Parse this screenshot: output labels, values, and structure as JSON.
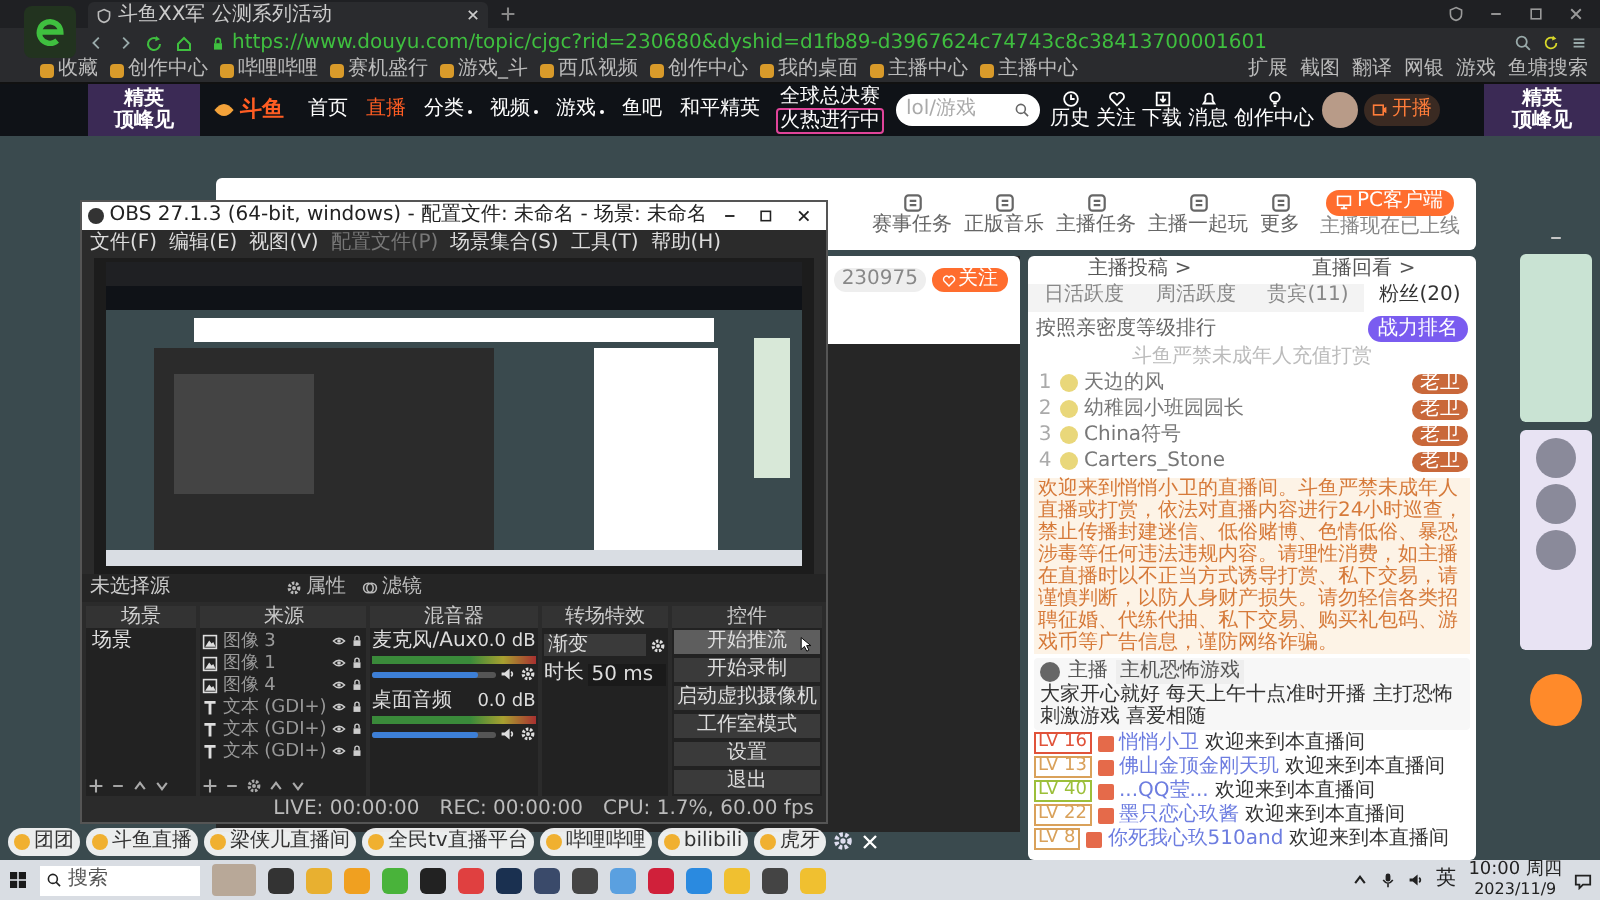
{
  "browser": {
    "tab_title": "斗鱼XX军 公测系列活动",
    "url": "https://www.douyu.com/topic/cjgc?rid=230680&dyshid=d1fb89-d3967624c74743c8c38413700001601",
    "bookmarks": [
      "收藏",
      "创作中心",
      "哔哩哔哩",
      "赛机盛行",
      "游戏_斗",
      "西瓜视频",
      "创作中心",
      "我的桌面",
      "主播中心",
      "主播中心"
    ],
    "bookmarks_right": [
      "扩展",
      "截图",
      "翻译",
      "网银",
      "游戏",
      "鱼塘搜索"
    ]
  },
  "site_nav": {
    "banner_left": [
      "精英",
      "顶峰见"
    ],
    "logo": "斗鱼",
    "items": [
      {
        "label": "首页",
        "selected": false,
        "dropdown": false
      },
      {
        "label": "直播",
        "selected": true,
        "dropdown": false
      },
      {
        "label": "分类",
        "selected": false,
        "dropdown": true
      },
      {
        "label": "视频",
        "selected": false,
        "dropdown": true
      },
      {
        "label": "游戏",
        "selected": false,
        "dropdown": true
      },
      {
        "label": "鱼吧",
        "selected": false,
        "dropdown": false
      },
      {
        "label": "和平精英",
        "selected": false,
        "dropdown": false
      }
    ],
    "promo": [
      "全球总决赛",
      "火热进行中"
    ],
    "search": {
      "placeholder": "lol/游戏"
    },
    "user_menu": [
      {
        "kind": "clock",
        "label": "历史"
      },
      {
        "kind": "heart",
        "label": "关注"
      },
      {
        "kind": "download",
        "label": "下载"
      },
      {
        "kind": "bell",
        "label": "消息"
      },
      {
        "kind": "bulb",
        "label": "创作中心"
      }
    ],
    "start_button": "开播",
    "banner_right": [
      "精英",
      "顶峰见"
    ]
  },
  "toolbar": {
    "tools": [
      "赛事任务",
      "正版音乐",
      "主播任务",
      "主播一起玩",
      "更多"
    ],
    "pc_button": "PC客户端",
    "pc_note": "主播现在已上线"
  },
  "player": {
    "follower_count": "230975",
    "follow_button": "关注"
  },
  "chat": {
    "links": [
      "主播投稿 >",
      "直播回看 >"
    ],
    "tabs": [
      {
        "label": "日活跃度",
        "selected": false
      },
      {
        "label": "周活跃度",
        "selected": false
      },
      {
        "label": "贵宾(11)",
        "selected": false
      },
      {
        "label": "粉丝(20)",
        "selected": true
      }
    ],
    "rank_note": "按照亲密度等级排行",
    "rank_button": "战力排名",
    "warning": "斗鱼严禁未成年人充值打赏",
    "fans": [
      {
        "rank": "1",
        "name": "天边的风",
        "badge": "老卫"
      },
      {
        "rank": "2",
        "name": "幼稚园小班园园长",
        "badge": "老卫"
      },
      {
        "rank": "3",
        "name": "China符号",
        "badge": "老卫"
      },
      {
        "rank": "4",
        "name": "Carters_Stone",
        "badge": "老卫"
      }
    ],
    "notice": "欢迎来到悄悄小卫的直播间。斗鱼严禁未成年人直播或打赏，依法对直播内容进行24小时巡查，禁止传播封建迷信、低俗赌博、色情低俗、暴恐涉毒等任何违法违规内容。请理性消费，如主播在直播时以不正当方式诱导打赏、私下交易，请谨慎判断，以防人身财产损失。请勿轻信各类招聘征婚、代练代抽、私下交易、购买礼包码、游戏币等广告信息，谨防网络诈骗。",
    "host_card": {
      "role": "主播",
      "tag": "主机恐怖游戏",
      "message": "大家开心就好 每天上午十点准时开播 主打恐怖刺激游戏 喜爱相随"
    },
    "welcome": [
      {
        "level": "LV 16",
        "color": "#e0533a",
        "name": "悄悄小卫",
        "text": "欢迎来到本直播间"
      },
      {
        "level": "LV 13",
        "color": "#d9a15a",
        "name": "佛山金顶金刚天玑",
        "text": "欢迎来到本直播间"
      },
      {
        "level": "LV 40",
        "color": "#9cbf3a",
        "name": "...QQ莹...",
        "text": "欢迎来到本直播间"
      },
      {
        "level": "LV 22",
        "color": "#d9a15a",
        "name": "墨只恋心玖酱",
        "text": "欢迎来到本直播间"
      },
      {
        "level": "LV 8",
        "color": "#d9a15a",
        "name": "你死我心玖510and",
        "text": "欢迎来到本直播间"
      }
    ]
  },
  "bottom_bookmarks": [
    "团团",
    "斗鱼直播",
    "梁侠儿直播间",
    "全民tv直播平台",
    "哔哩哔哩",
    "bilibili",
    "虎牙"
  ],
  "obs": {
    "title": "OBS 27.1.3 (64-bit, windows) - 配置文件: 未命名 - 场景: 未命名",
    "menu": [
      {
        "label": "文件(F)",
        "disabled": false
      },
      {
        "label": "编辑(E)",
        "disabled": false
      },
      {
        "label": "视图(V)",
        "disabled": false
      },
      {
        "label": "配置文件(P)",
        "disabled": true
      },
      {
        "label": "场景集合(S)",
        "disabled": false
      },
      {
        "label": "工具(T)",
        "disabled": false
      },
      {
        "label": "帮助(H)",
        "disabled": false
      }
    ],
    "source_bar": {
      "label": "未选择源",
      "buttons": [
        "属性",
        "滤镜"
      ]
    },
    "docks": [
      "场景",
      "来源",
      "混音器",
      "转场特效",
      "控件"
    ],
    "scenes": [
      {
        "name": "场景",
        "selected": false
      }
    ],
    "sources": [
      {
        "kind": "image",
        "name": "图像 3"
      },
      {
        "kind": "image",
        "name": "图像 1"
      },
      {
        "kind": "image",
        "name": "图像 4"
      },
      {
        "kind": "text",
        "name": "文本 (GDI+)"
      },
      {
        "kind": "text",
        "name": "文本 (GDI+)"
      },
      {
        "kind": "text",
        "name": "文本 (GDI+)"
      }
    ],
    "mixer": [
      {
        "name": "麦克风/Aux",
        "reading": "0.0 dB",
        "level": 0.85
      },
      {
        "name": "桌面音频",
        "reading": "0.0 dB",
        "level": 0.85
      }
    ],
    "transition": {
      "type": "渐变",
      "duration_label": "时长",
      "duration": "50 ms"
    },
    "controls": [
      {
        "label": "开始推流",
        "hovered": true
      },
      {
        "label": "开始录制",
        "hovered": false
      },
      {
        "label": "启动虚拟摄像机",
        "hovered": false
      },
      {
        "label": "工作室模式",
        "hovered": false
      },
      {
        "label": "设置",
        "hovered": false
      },
      {
        "label": "退出",
        "hovered": false
      }
    ],
    "status": [
      "LIVE: 00:00:00",
      "REC: 00:00:00",
      "CPU: 1.7%, 60.00 fps"
    ]
  },
  "taskbar": {
    "search_placeholder": "搜索",
    "ime": "英",
    "time": "10:00 周四",
    "date": "2023/11/9"
  }
}
